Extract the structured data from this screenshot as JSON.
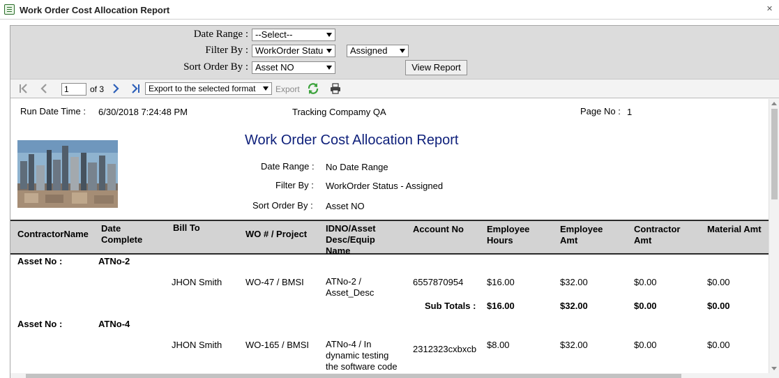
{
  "window": {
    "title": "Work Order Cost Allocation Report",
    "close_glyph": "✕"
  },
  "params": {
    "date_range_label": "Date Range :",
    "date_range_value": "--Select--",
    "filter_by_label": "Filter By :",
    "filter_by_value": "WorkOrder Statu",
    "filter_by_value2": "Assigned",
    "sort_order_label": "Sort Order By :",
    "sort_order_value": "Asset NO",
    "view_report": "View Report"
  },
  "toolbar": {
    "page": "1",
    "of_pages": "of 3",
    "export_format": "Export to the selected format",
    "export": "Export"
  },
  "report": {
    "run_date_label": "Run Date Time :",
    "run_date_value": "6/30/2018 7:24:48 PM",
    "company": "Tracking Compamy QA",
    "page_label": "Page No :",
    "page_value": "1",
    "title": "Work Order Cost Allocation Report",
    "date_range_label": "Date Range :",
    "date_range_value": "No Date Range",
    "filter_by_label": "Filter By :",
    "filter_by_value": "WorkOrder Status - Assigned",
    "sort_by_label": "Sort Order By :",
    "sort_by_value": "Asset NO"
  },
  "columns": [
    [
      "ContractorName"
    ],
    [
      "Date",
      "Complete"
    ],
    [
      "Bill To"
    ],
    [
      "WO # / Project"
    ],
    [
      "IDNO/Asset",
      "Desc/Equip",
      "Name"
    ],
    [
      "Account No"
    ],
    [
      "Employee",
      "Hours"
    ],
    [
      "Employee",
      "Amt"
    ],
    [
      "Contractor",
      "Amt"
    ],
    [
      "Material Amt"
    ]
  ],
  "groups": [
    {
      "asset_label": "Asset No :",
      "asset_no": "ATNo-2",
      "rows": [
        {
          "bill_to": "JHON Smith",
          "wo": "WO-47 / BMSI",
          "idno": [
            "ATNo-2 /",
            "Asset_Desc"
          ],
          "account": "6557870954",
          "emp_hours": "$16.00",
          "emp_amt": "$32.00",
          "contractor_amt": "$0.00",
          "material_amt": "$0.00"
        }
      ],
      "subtotal_label": "Sub Totals :",
      "subtotal": {
        "emp_hours": "$16.00",
        "emp_amt": "$32.00",
        "contractor_amt": "$0.00",
        "material_amt": "$0.00"
      }
    },
    {
      "asset_label": "Asset No :",
      "asset_no": "ATNo-4",
      "rows": [
        {
          "bill_to": "JHON Smith",
          "wo": "WO-165 / BMSI",
          "idno": [
            "ATNo-4 / In",
            "dynamic testing",
            "the software code"
          ],
          "account": "2312323cxbxcb",
          "emp_hours": "$8.00",
          "emp_amt": "$32.00",
          "contractor_amt": "$0.00",
          "material_amt": "$0.00"
        }
      ]
    }
  ],
  "colors": {
    "title_blue": "#0d1f7a",
    "param_bg": "#dcdcdc",
    "header_bg": "#d3d3d3",
    "refresh_green": "#3aa23a"
  },
  "icons": [
    "list-icon",
    "close-icon",
    "first-page-icon",
    "prev-page-icon",
    "next-page-icon",
    "last-page-icon",
    "refresh-icon",
    "print-icon"
  ]
}
